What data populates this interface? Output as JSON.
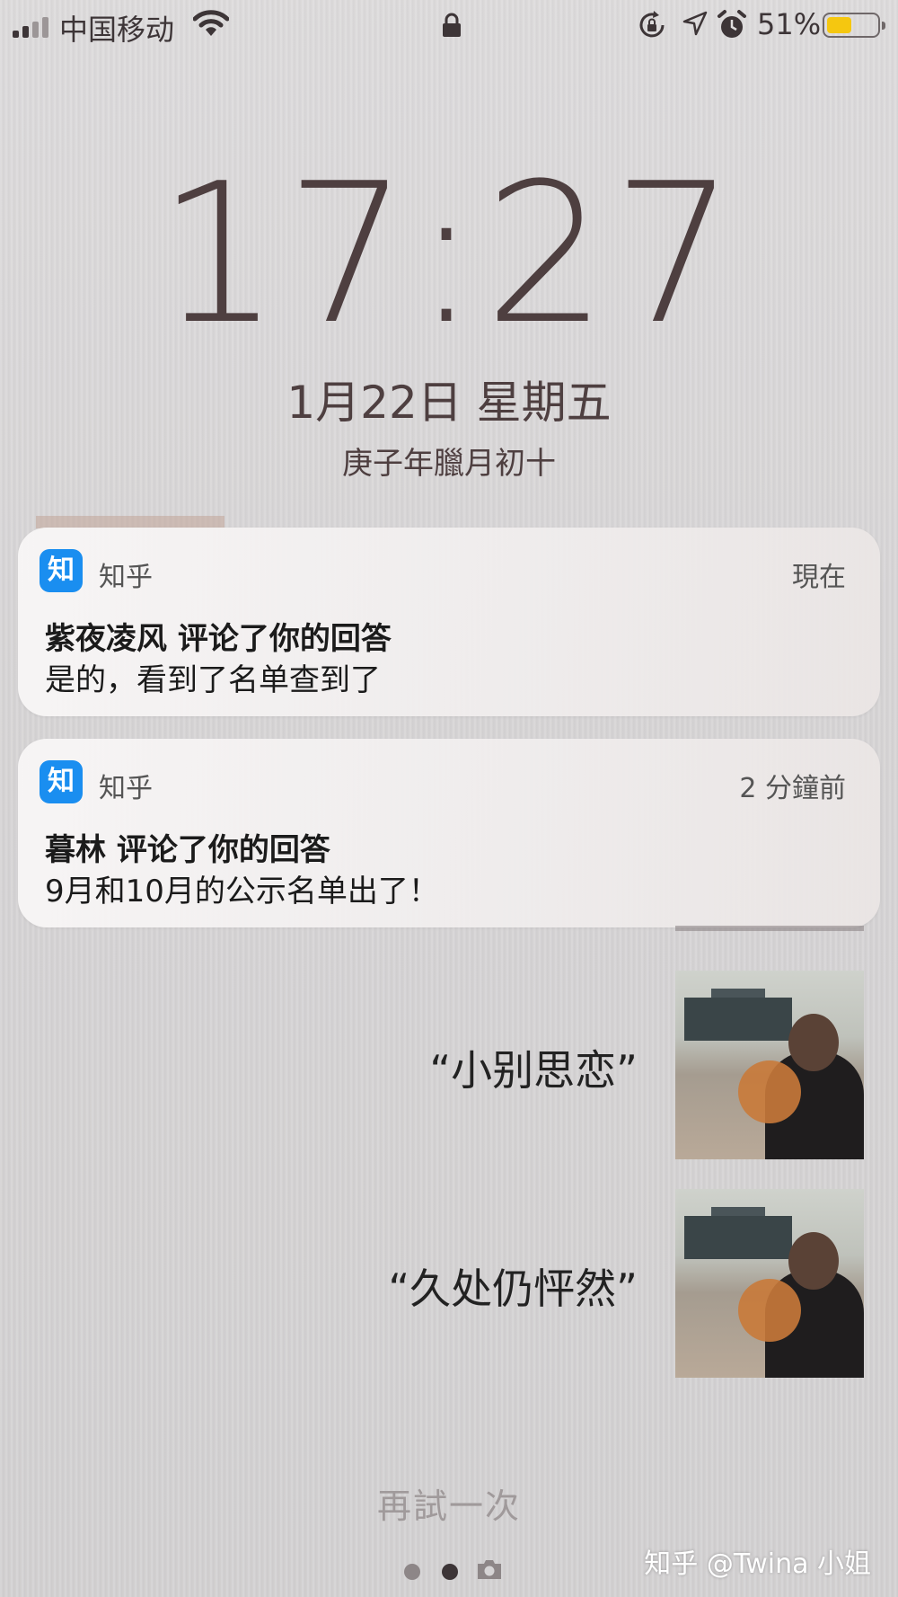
{
  "status_bar": {
    "carrier": "中国移动",
    "battery_percent": "51%",
    "battery_level": 0.51,
    "icons": [
      "signal-icon",
      "wifi-icon",
      "lock-icon",
      "rotation-lock-icon",
      "location-icon",
      "alarm-icon",
      "battery-icon"
    ]
  },
  "lockscreen": {
    "time": "17:27",
    "date": "1月22日 星期五",
    "lunar_date": "庚子年臘月初十"
  },
  "notifications": [
    {
      "app_icon": "知",
      "app_name": "知乎",
      "time_ago": "現在",
      "title": "紫夜凌风 评论了你的回答",
      "body": "是的，看到了名单查到了"
    },
    {
      "app_icon": "知",
      "app_name": "知乎",
      "time_ago": "2 分鐘前",
      "title": "暮林 评论了你的回答",
      "body": "9月和10月的公示名单出了！"
    }
  ],
  "background_content": {
    "quotes": [
      "“小别思恋”",
      "“久处仍怦然”"
    ],
    "retry_label": "再試一次"
  },
  "page_indicator": {
    "page_count": 2,
    "active_index": 1
  },
  "watermark": "知乎 @Twina 小姐",
  "colors": {
    "app_icon_bg": "#1a8ef0",
    "battery_fill": "#f5c710",
    "text_dark": "#4e3f40"
  }
}
